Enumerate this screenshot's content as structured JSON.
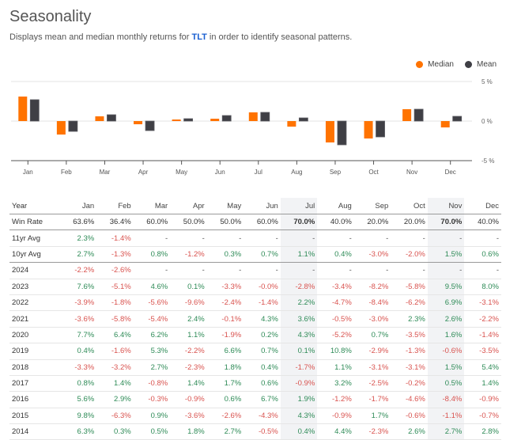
{
  "title": "Seasonality",
  "subtitle": {
    "prefix": "Displays mean and median monthly returns for ",
    "ticker": "TLT",
    "suffix": " in order to identify seasonal patterns."
  },
  "colors": {
    "median": "#ff7300",
    "mean": "#3f3f45",
    "positive": "#2e8b57",
    "negative": "#d9534f",
    "highlight": "#f2f3f5"
  },
  "chart_data": {
    "type": "bar",
    "title": "",
    "categories": [
      "Jan",
      "Feb",
      "Mar",
      "Apr",
      "May",
      "Jun",
      "Jul",
      "Aug",
      "Sep",
      "Oct",
      "Nov",
      "Dec"
    ],
    "series": [
      {
        "name": "Median",
        "values": [
          3.1,
          -1.7,
          0.6,
          -0.4,
          0.2,
          0.3,
          1.1,
          -0.7,
          -2.7,
          -2.2,
          1.5,
          -0.8
        ]
      },
      {
        "name": "Mean",
        "values": [
          2.7,
          -1.3,
          0.8,
          -1.2,
          0.3,
          0.7,
          1.1,
          0.4,
          -3.0,
          -2.0,
          1.5,
          0.6
        ]
      }
    ],
    "xlabel": "",
    "ylabel": "",
    "ylim": [
      -5,
      5
    ],
    "yticks": [
      "5 %",
      "0 %",
      "-5 %"
    ],
    "ytick_values": [
      5,
      0,
      -5
    ],
    "grid": true,
    "legend": "top-right"
  },
  "legend": [
    {
      "label": "Median"
    },
    {
      "label": "Mean"
    }
  ],
  "table": {
    "headers": [
      "Year",
      "Jan",
      "Feb",
      "Mar",
      "Apr",
      "May",
      "Jun",
      "Jul",
      "Aug",
      "Sep",
      "Oct",
      "Nov",
      "Dec"
    ],
    "highlight_months": [
      "Jul",
      "Nov"
    ],
    "win_rate": {
      "label": "Win Rate",
      "values": [
        "63.6%",
        "36.4%",
        "60.0%",
        "50.0%",
        "50.0%",
        "60.0%",
        "70.0%",
        "40.0%",
        "20.0%",
        "20.0%",
        "70.0%",
        "40.0%"
      ]
    },
    "rows": [
      {
        "label": "11yr Avg",
        "values": [
          "2.3%",
          "-1.4%",
          "-",
          "-",
          "-",
          "-",
          "-",
          "-",
          "-",
          "-",
          "-",
          "-"
        ]
      },
      {
        "label": "10yr Avg",
        "values": [
          "2.7%",
          "-1.3%",
          "0.8%",
          "-1.2%",
          "0.3%",
          "0.7%",
          "1.1%",
          "0.4%",
          "-3.0%",
          "-2.0%",
          "1.5%",
          "0.6%"
        ]
      },
      {
        "label": "2024",
        "values": [
          "-2.2%",
          "-2.6%",
          "-",
          "-",
          "-",
          "-",
          "-",
          "-",
          "-",
          "-",
          "-",
          "-"
        ]
      },
      {
        "label": "2023",
        "values": [
          "7.6%",
          "-5.1%",
          "4.6%",
          "0.1%",
          "-3.3%",
          "-0.0%",
          "-2.8%",
          "-3.4%",
          "-8.2%",
          "-5.8%",
          "9.5%",
          "8.0%"
        ]
      },
      {
        "label": "2022",
        "values": [
          "-3.9%",
          "-1.8%",
          "-5.6%",
          "-9.6%",
          "-2.4%",
          "-1.4%",
          "2.2%",
          "-4.7%",
          "-8.4%",
          "-6.2%",
          "6.9%",
          "-3.1%"
        ]
      },
      {
        "label": "2021",
        "values": [
          "-3.6%",
          "-5.8%",
          "-5.4%",
          "2.4%",
          "-0.1%",
          "4.3%",
          "3.6%",
          "-0.5%",
          "-3.0%",
          "2.3%",
          "2.6%",
          "-2.2%"
        ]
      },
      {
        "label": "2020",
        "values": [
          "7.7%",
          "6.4%",
          "6.2%",
          "1.1%",
          "-1.9%",
          "0.2%",
          "4.3%",
          "-5.2%",
          "0.7%",
          "-3.5%",
          "1.6%",
          "-1.4%"
        ]
      },
      {
        "label": "2019",
        "values": [
          "0.4%",
          "-1.6%",
          "5.3%",
          "-2.2%",
          "6.6%",
          "0.7%",
          "0.1%",
          "10.8%",
          "-2.9%",
          "-1.3%",
          "-0.6%",
          "-3.5%"
        ]
      },
      {
        "label": "2018",
        "values": [
          "-3.3%",
          "-3.2%",
          "2.7%",
          "-2.3%",
          "1.8%",
          "0.4%",
          "-1.7%",
          "1.1%",
          "-3.1%",
          "-3.1%",
          "1.5%",
          "5.4%"
        ]
      },
      {
        "label": "2017",
        "values": [
          "0.8%",
          "1.4%",
          "-0.8%",
          "1.4%",
          "1.7%",
          "0.6%",
          "-0.9%",
          "3.2%",
          "-2.5%",
          "-0.2%",
          "0.5%",
          "1.4%"
        ]
      },
      {
        "label": "2016",
        "values": [
          "5.6%",
          "2.9%",
          "-0.3%",
          "-0.9%",
          "0.6%",
          "6.7%",
          "1.9%",
          "-1.2%",
          "-1.7%",
          "-4.6%",
          "-8.4%",
          "-0.9%"
        ]
      },
      {
        "label": "2015",
        "values": [
          "9.8%",
          "-6.3%",
          "0.9%",
          "-3.6%",
          "-2.6%",
          "-4.3%",
          "4.3%",
          "-0.9%",
          "1.7%",
          "-0.6%",
          "-1.1%",
          "-0.7%"
        ]
      },
      {
        "label": "2014",
        "values": [
          "6.3%",
          "0.3%",
          "0.5%",
          "1.8%",
          "2.7%",
          "-0.5%",
          "0.4%",
          "4.4%",
          "-2.3%",
          "2.6%",
          "2.7%",
          "2.8%"
        ]
      }
    ]
  }
}
